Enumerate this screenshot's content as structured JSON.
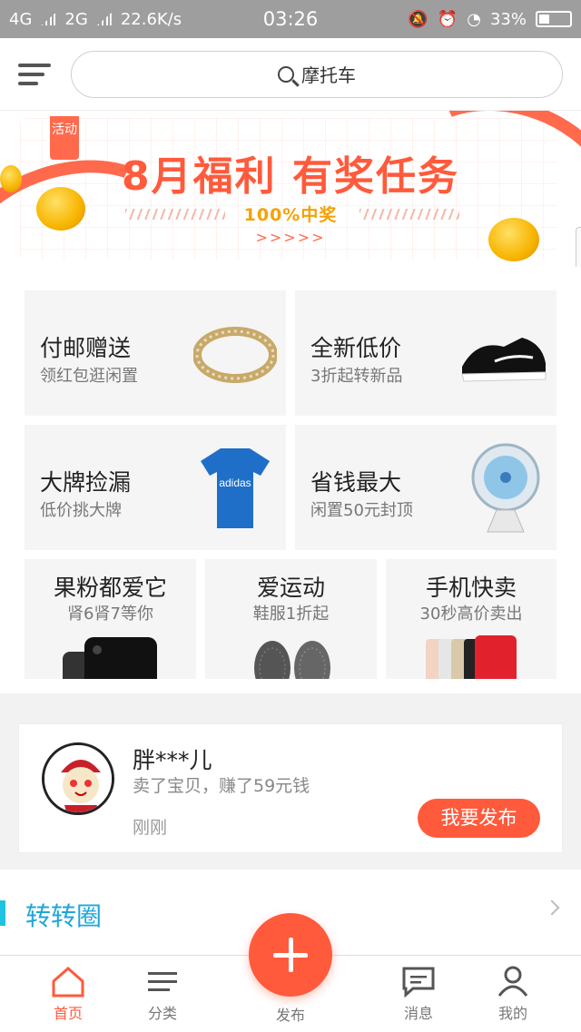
{
  "status_bar": {
    "net1": "4G",
    "net2": "2G",
    "speed": "22.6K/s",
    "time": "03:26",
    "battery": "33%"
  },
  "search": {
    "placeholder": "摩托车"
  },
  "banner": {
    "tag": "活动",
    "title": "8月福利 有奖任务",
    "subtitle": "100%中奖",
    "arrows": ">>>>>"
  },
  "tiles": [
    {
      "title": "付邮赠送",
      "subtitle": "领红包逛闲置",
      "icon": "bracelet-image"
    },
    {
      "title": "全新低价",
      "subtitle": "3折起转新品",
      "icon": "sneaker-image"
    },
    {
      "title": "大牌捡漏",
      "subtitle": "低价挑大牌",
      "icon": "tshirt-image",
      "image_text": "adidas"
    },
    {
      "title": "省钱最大",
      "subtitle": "闲置50元封顶",
      "icon": "fan-image"
    },
    {
      "title": "果粉都爱它",
      "subtitle": "肾6肾7等你",
      "icon": "iphone-image"
    },
    {
      "title": "爱运动",
      "subtitle": "鞋服1折起",
      "icon": "shoes-image"
    },
    {
      "title": "手机快卖",
      "subtitle": "30秒高价卖出",
      "icon": "phones-image"
    }
  ],
  "feed": {
    "user": "胖***儿",
    "desc": "卖了宝贝，赚了59元钱",
    "time": "刚刚",
    "button": "我要发布"
  },
  "section": {
    "title": "转转圈"
  },
  "tabbar": [
    {
      "label": "首页",
      "icon": "home-icon"
    },
    {
      "label": "分类",
      "icon": "list-icon"
    },
    {
      "label": "发布",
      "icon": "plus-icon"
    },
    {
      "label": "消息",
      "icon": "message-icon"
    },
    {
      "label": "我的",
      "icon": "user-icon"
    }
  ],
  "colors": {
    "accent": "#ff5a3c",
    "section": "#1fa6d8"
  }
}
